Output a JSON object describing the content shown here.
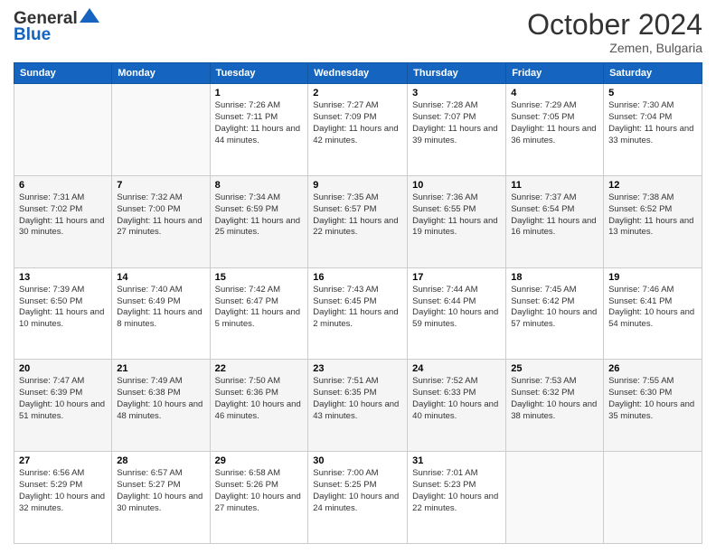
{
  "header": {
    "logo_general": "General",
    "logo_blue": "Blue",
    "month_title": "October 2024",
    "location": "Zemen, Bulgaria"
  },
  "days_of_week": [
    "Sunday",
    "Monday",
    "Tuesday",
    "Wednesday",
    "Thursday",
    "Friday",
    "Saturday"
  ],
  "weeks": [
    [
      {
        "day": "",
        "sunrise": "",
        "sunset": "",
        "daylight": ""
      },
      {
        "day": "",
        "sunrise": "",
        "sunset": "",
        "daylight": ""
      },
      {
        "day": "1",
        "sunrise": "Sunrise: 7:26 AM",
        "sunset": "Sunset: 7:11 PM",
        "daylight": "Daylight: 11 hours and 44 minutes."
      },
      {
        "day": "2",
        "sunrise": "Sunrise: 7:27 AM",
        "sunset": "Sunset: 7:09 PM",
        "daylight": "Daylight: 11 hours and 42 minutes."
      },
      {
        "day": "3",
        "sunrise": "Sunrise: 7:28 AM",
        "sunset": "Sunset: 7:07 PM",
        "daylight": "Daylight: 11 hours and 39 minutes."
      },
      {
        "day": "4",
        "sunrise": "Sunrise: 7:29 AM",
        "sunset": "Sunset: 7:05 PM",
        "daylight": "Daylight: 11 hours and 36 minutes."
      },
      {
        "day": "5",
        "sunrise": "Sunrise: 7:30 AM",
        "sunset": "Sunset: 7:04 PM",
        "daylight": "Daylight: 11 hours and 33 minutes."
      }
    ],
    [
      {
        "day": "6",
        "sunrise": "Sunrise: 7:31 AM",
        "sunset": "Sunset: 7:02 PM",
        "daylight": "Daylight: 11 hours and 30 minutes."
      },
      {
        "day": "7",
        "sunrise": "Sunrise: 7:32 AM",
        "sunset": "Sunset: 7:00 PM",
        "daylight": "Daylight: 11 hours and 27 minutes."
      },
      {
        "day": "8",
        "sunrise": "Sunrise: 7:34 AM",
        "sunset": "Sunset: 6:59 PM",
        "daylight": "Daylight: 11 hours and 25 minutes."
      },
      {
        "day": "9",
        "sunrise": "Sunrise: 7:35 AM",
        "sunset": "Sunset: 6:57 PM",
        "daylight": "Daylight: 11 hours and 22 minutes."
      },
      {
        "day": "10",
        "sunrise": "Sunrise: 7:36 AM",
        "sunset": "Sunset: 6:55 PM",
        "daylight": "Daylight: 11 hours and 19 minutes."
      },
      {
        "day": "11",
        "sunrise": "Sunrise: 7:37 AM",
        "sunset": "Sunset: 6:54 PM",
        "daylight": "Daylight: 11 hours and 16 minutes."
      },
      {
        "day": "12",
        "sunrise": "Sunrise: 7:38 AM",
        "sunset": "Sunset: 6:52 PM",
        "daylight": "Daylight: 11 hours and 13 minutes."
      }
    ],
    [
      {
        "day": "13",
        "sunrise": "Sunrise: 7:39 AM",
        "sunset": "Sunset: 6:50 PM",
        "daylight": "Daylight: 11 hours and 10 minutes."
      },
      {
        "day": "14",
        "sunrise": "Sunrise: 7:40 AM",
        "sunset": "Sunset: 6:49 PM",
        "daylight": "Daylight: 11 hours and 8 minutes."
      },
      {
        "day": "15",
        "sunrise": "Sunrise: 7:42 AM",
        "sunset": "Sunset: 6:47 PM",
        "daylight": "Daylight: 11 hours and 5 minutes."
      },
      {
        "day": "16",
        "sunrise": "Sunrise: 7:43 AM",
        "sunset": "Sunset: 6:45 PM",
        "daylight": "Daylight: 11 hours and 2 minutes."
      },
      {
        "day": "17",
        "sunrise": "Sunrise: 7:44 AM",
        "sunset": "Sunset: 6:44 PM",
        "daylight": "Daylight: 10 hours and 59 minutes."
      },
      {
        "day": "18",
        "sunrise": "Sunrise: 7:45 AM",
        "sunset": "Sunset: 6:42 PM",
        "daylight": "Daylight: 10 hours and 57 minutes."
      },
      {
        "day": "19",
        "sunrise": "Sunrise: 7:46 AM",
        "sunset": "Sunset: 6:41 PM",
        "daylight": "Daylight: 10 hours and 54 minutes."
      }
    ],
    [
      {
        "day": "20",
        "sunrise": "Sunrise: 7:47 AM",
        "sunset": "Sunset: 6:39 PM",
        "daylight": "Daylight: 10 hours and 51 minutes."
      },
      {
        "day": "21",
        "sunrise": "Sunrise: 7:49 AM",
        "sunset": "Sunset: 6:38 PM",
        "daylight": "Daylight: 10 hours and 48 minutes."
      },
      {
        "day": "22",
        "sunrise": "Sunrise: 7:50 AM",
        "sunset": "Sunset: 6:36 PM",
        "daylight": "Daylight: 10 hours and 46 minutes."
      },
      {
        "day": "23",
        "sunrise": "Sunrise: 7:51 AM",
        "sunset": "Sunset: 6:35 PM",
        "daylight": "Daylight: 10 hours and 43 minutes."
      },
      {
        "day": "24",
        "sunrise": "Sunrise: 7:52 AM",
        "sunset": "Sunset: 6:33 PM",
        "daylight": "Daylight: 10 hours and 40 minutes."
      },
      {
        "day": "25",
        "sunrise": "Sunrise: 7:53 AM",
        "sunset": "Sunset: 6:32 PM",
        "daylight": "Daylight: 10 hours and 38 minutes."
      },
      {
        "day": "26",
        "sunrise": "Sunrise: 7:55 AM",
        "sunset": "Sunset: 6:30 PM",
        "daylight": "Daylight: 10 hours and 35 minutes."
      }
    ],
    [
      {
        "day": "27",
        "sunrise": "Sunrise: 6:56 AM",
        "sunset": "Sunset: 5:29 PM",
        "daylight": "Daylight: 10 hours and 32 minutes."
      },
      {
        "day": "28",
        "sunrise": "Sunrise: 6:57 AM",
        "sunset": "Sunset: 5:27 PM",
        "daylight": "Daylight: 10 hours and 30 minutes."
      },
      {
        "day": "29",
        "sunrise": "Sunrise: 6:58 AM",
        "sunset": "Sunset: 5:26 PM",
        "daylight": "Daylight: 10 hours and 27 minutes."
      },
      {
        "day": "30",
        "sunrise": "Sunrise: 7:00 AM",
        "sunset": "Sunset: 5:25 PM",
        "daylight": "Daylight: 10 hours and 24 minutes."
      },
      {
        "day": "31",
        "sunrise": "Sunrise: 7:01 AM",
        "sunset": "Sunset: 5:23 PM",
        "daylight": "Daylight: 10 hours and 22 minutes."
      },
      {
        "day": "",
        "sunrise": "",
        "sunset": "",
        "daylight": ""
      },
      {
        "day": "",
        "sunrise": "",
        "sunset": "",
        "daylight": ""
      }
    ]
  ]
}
